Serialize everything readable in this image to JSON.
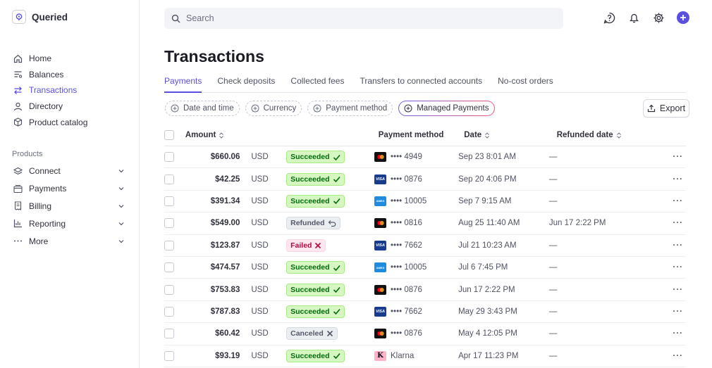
{
  "app": {
    "name": "Queried"
  },
  "sidebar": {
    "items": [
      {
        "label": "Home",
        "icon": "home-icon"
      },
      {
        "label": "Balances",
        "icon": "balances-icon"
      },
      {
        "label": "Transactions",
        "icon": "transactions-icon",
        "active": true
      },
      {
        "label": "Directory",
        "icon": "person-icon"
      },
      {
        "label": "Product catalog",
        "icon": "box-icon"
      }
    ],
    "section_label": "Products",
    "product_items": [
      {
        "label": "Connect",
        "icon": "layers-icon"
      },
      {
        "label": "Payments",
        "icon": "wallet-icon"
      },
      {
        "label": "Billing",
        "icon": "receipt-icon"
      },
      {
        "label": "Reporting",
        "icon": "bar-chart-icon"
      },
      {
        "label": "More",
        "icon": "ellipsis-icon"
      }
    ]
  },
  "search": {
    "placeholder": "Search"
  },
  "page": {
    "title": "Transactions"
  },
  "tabs": [
    "Payments",
    "Check deposits",
    "Collected fees",
    "Transfers to connected accounts",
    "No-cost orders"
  ],
  "filters": [
    "Date and time",
    "Currency",
    "Payment method",
    "Managed Payments"
  ],
  "export_label": "Export",
  "table": {
    "headers": {
      "amount": "Amount",
      "payment_method": "Payment method",
      "date": "Date",
      "refunded_date": "Refunded date"
    },
    "rows": [
      {
        "amount": "$660.06",
        "currency": "USD",
        "status": "Succeeded",
        "status_type": "succeeded",
        "card": "mastercard",
        "pm": "•••• 4949",
        "date": "Sep 23 8:01 AM",
        "refunded": "—"
      },
      {
        "amount": "$42.25",
        "currency": "USD",
        "status": "Succeeded",
        "status_type": "succeeded",
        "card": "visa",
        "pm": "•••• 0876",
        "date": "Sep 20 4:06 PM",
        "refunded": "—"
      },
      {
        "amount": "$391.34",
        "currency": "USD",
        "status": "Succeeded",
        "status_type": "succeeded",
        "card": "amex",
        "pm": "•••• 10005",
        "date": "Sep 7 9:15 AM",
        "refunded": "—"
      },
      {
        "amount": "$549.00",
        "currency": "USD",
        "status": "Refunded",
        "status_type": "refunded",
        "card": "mastercard",
        "pm": "•••• 0816",
        "date": "Aug 25 11:40 AM",
        "refunded": "Jun 17 2:22 PM"
      },
      {
        "amount": "$123.87",
        "currency": "USD",
        "status": "Failed",
        "status_type": "failed",
        "card": "visa",
        "pm": "•••• 7662",
        "date": "Jul 21 10:23 AM",
        "refunded": "—"
      },
      {
        "amount": "$474.57",
        "currency": "USD",
        "status": "Succeeded",
        "status_type": "succeeded",
        "card": "amex",
        "pm": "•••• 10005",
        "date": "Jul 6 7:45 PM",
        "refunded": "—"
      },
      {
        "amount": "$753.83",
        "currency": "USD",
        "status": "Succeeded",
        "status_type": "succeeded",
        "card": "mastercard",
        "pm": "•••• 0876",
        "date": "Jun 17 2:22 PM",
        "refunded": "—"
      },
      {
        "amount": "$787.83",
        "currency": "USD",
        "status": "Succeeded",
        "status_type": "succeeded",
        "card": "visa",
        "pm": "•••• 7662",
        "date": "May 29 3:43 PM",
        "refunded": "—"
      },
      {
        "amount": "$60.42",
        "currency": "USD",
        "status": "Canceled",
        "status_type": "canceled",
        "card": "mastercard",
        "pm": "•••• 0876",
        "date": "May 4 12:05 PM",
        "refunded": "—"
      },
      {
        "amount": "$93.19",
        "currency": "USD",
        "status": "Succeeded",
        "status_type": "succeeded",
        "card": "klarna",
        "pm": "Klarna",
        "date": "Apr 17 11:23 PM",
        "refunded": "—"
      }
    ]
  },
  "colors": {
    "accent": "#5b4fe0",
    "success_bg": "#d7f7c2",
    "success_fg": "#05690d",
    "failed_fg": "#b3093c"
  }
}
